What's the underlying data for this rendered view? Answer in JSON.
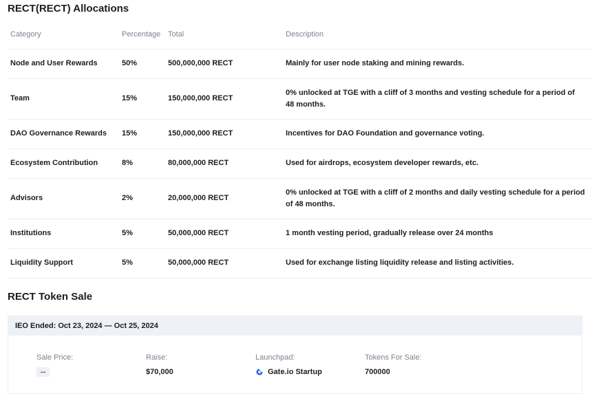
{
  "allocations": {
    "title": "RECT(RECT) Allocations",
    "headers": {
      "category": "Category",
      "percentage": "Percentage",
      "total": "Total",
      "description": "Description"
    },
    "rows": [
      {
        "category": "Node and User Rewards",
        "percentage": "50%",
        "total": "500,000,000 RECT",
        "description": "Mainly for user node staking and mining rewards."
      },
      {
        "category": "Team",
        "percentage": "15%",
        "total": "150,000,000 RECT",
        "description": "0% unlocked at TGE with a cliff of 3 months and vesting schedule for a period of 48 months."
      },
      {
        "category": "DAO Governance Rewards",
        "percentage": "15%",
        "total": "150,000,000 RECT",
        "description": "Incentives for DAO Foundation and governance voting."
      },
      {
        "category": "Ecosystem Contribution",
        "percentage": "8%",
        "total": "80,000,000 RECT",
        "description": "Used for airdrops, ecosystem developer rewards, etc."
      },
      {
        "category": "Advisors",
        "percentage": "2%",
        "total": "20,000,000 RECT",
        "description": "0% unlocked at TGE with a cliff of 2 months and daily vesting schedule for a period of 48 months."
      },
      {
        "category": "Institutions",
        "percentage": "5%",
        "total": "50,000,000 RECT",
        "description": "1 month vesting period, gradually release over 24 months"
      },
      {
        "category": "Liquidity Support",
        "percentage": "5%",
        "total": "50,000,000 RECT",
        "description": "Used for exchange listing liquidity release and listing activities."
      }
    ]
  },
  "token_sale": {
    "title": "RECT Token Sale",
    "status": "IEO Ended: Oct 23, 2024 — Oct 25, 2024",
    "sale_price_label": "Sale Price:",
    "sale_price_value": "--",
    "raise_label": "Raise:",
    "raise_value": "$70,000",
    "launchpad_label": "Launchpad:",
    "launchpad_value": "Gate.io Startup",
    "launchpad_icon": "gate-io-logo-icon",
    "tokens_label": "Tokens For Sale:",
    "tokens_value": "700000"
  },
  "colors": {
    "gate_blue": "#2354e6",
    "gate_green": "#17e6a1",
    "muted_text": "#7b8290",
    "header_bg": "#eef1f5"
  }
}
